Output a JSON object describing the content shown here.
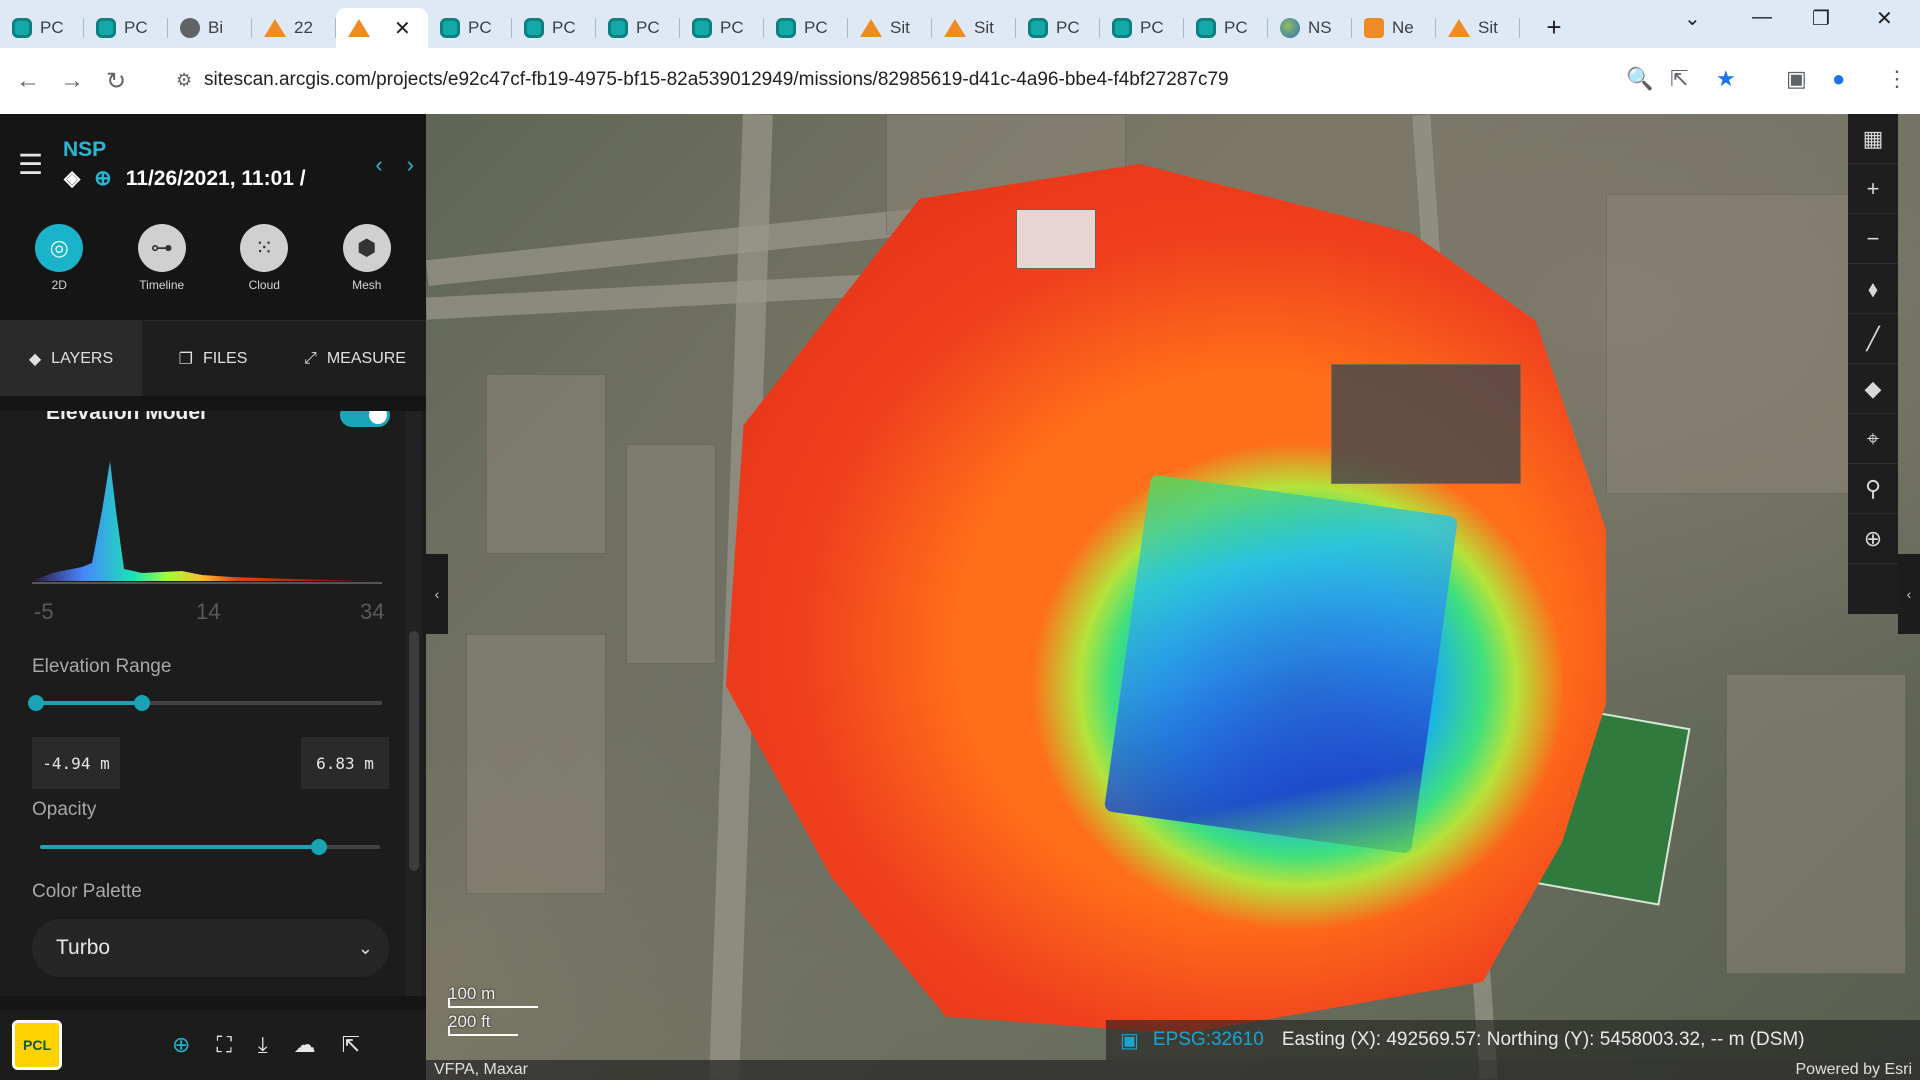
{
  "browser": {
    "tabs": [
      {
        "label": "PC",
        "icon": "teal"
      },
      {
        "label": "PC",
        "icon": "teal"
      },
      {
        "label": "Bi",
        "icon": "grey"
      },
      {
        "label": "22",
        "icon": "orange"
      },
      {
        "label": "",
        "icon": "orange",
        "active": true
      },
      {
        "label": "PC",
        "icon": "teal"
      },
      {
        "label": "PC",
        "icon": "teal"
      },
      {
        "label": "PC",
        "icon": "teal"
      },
      {
        "label": "PC",
        "icon": "teal"
      },
      {
        "label": "PC",
        "icon": "teal"
      },
      {
        "label": "Sit",
        "icon": "orange"
      },
      {
        "label": "Sit",
        "icon": "orange"
      },
      {
        "label": "PC",
        "icon": "teal"
      },
      {
        "label": "PC",
        "icon": "teal"
      },
      {
        "label": "PC",
        "icon": "teal"
      },
      {
        "label": "NS",
        "icon": "globe"
      },
      {
        "label": "Ne",
        "icon": "box"
      },
      {
        "label": "Sit",
        "icon": "orange"
      }
    ],
    "url": "sitescan.arcgis.com/projects/e92c47cf-fb19-4975-bf15-82a539012949/missions/82985619-d41c-4a96-bbe4-f4bf27287c79"
  },
  "sidebar": {
    "project": "NSP",
    "date": "11/26/2021, 11:01 /",
    "modes": [
      {
        "label": "2D",
        "icon": "fingerprint-icon",
        "active": true
      },
      {
        "label": "Timeline",
        "icon": "timeline-icon"
      },
      {
        "label": "Cloud",
        "icon": "cloud-points-icon"
      },
      {
        "label": "Mesh",
        "icon": "mesh-cube-icon"
      }
    ],
    "tabs": [
      {
        "label": "LAYERS",
        "active": true
      },
      {
        "label": "FILES"
      },
      {
        "label": "MEASURE"
      }
    ],
    "layer": {
      "title": "Elevation Model",
      "enabled": true,
      "histogram_labels": [
        "-5",
        "14",
        "34"
      ],
      "range_label": "Elevation Range",
      "range_min": "-4.94 m",
      "range_max": "6.83 m",
      "opacity_label": "Opacity",
      "opacity_value": 0.82,
      "palette_label": "Color Palette",
      "palette_value": "Turbo"
    },
    "logo_text": "PCL"
  },
  "map": {
    "scale_top": "100 m",
    "scale_bottom": "200 ft",
    "epsg": "EPSG:32610",
    "coords": "Easting (X): 492569.57: Northing (Y): 5458003.32, -- m (DSM)",
    "attribution_left": "VFPA, Maxar",
    "attribution_right": "Powered by Esri"
  },
  "colors": {
    "accent": "#1aa5b8",
    "brand_cyan": "#25b8d4"
  }
}
